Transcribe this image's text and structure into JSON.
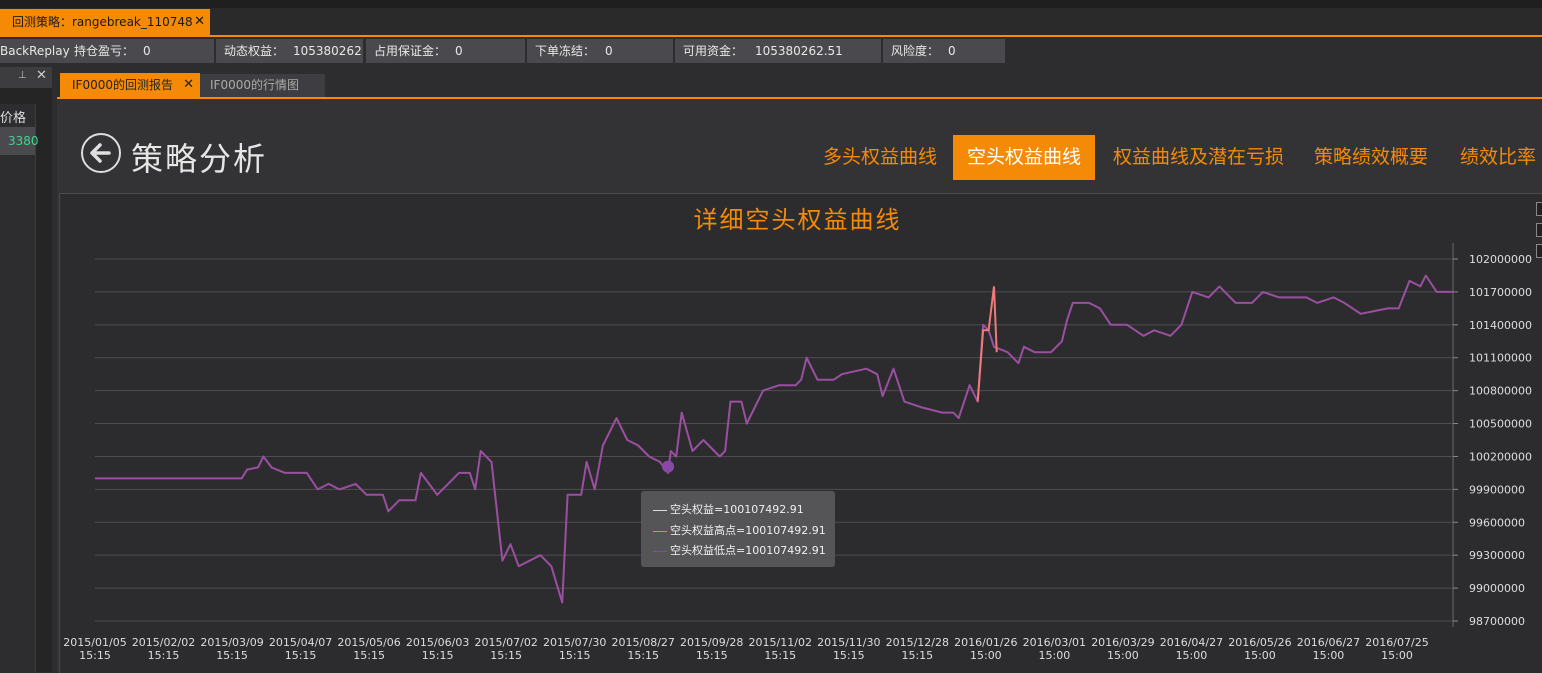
{
  "app": {
    "doc_tab_label": "回测策略：rangebreak_110748",
    "close_glyph": "✕"
  },
  "status_bar": {
    "left_label": "BackReplay",
    "fields": [
      {
        "label": "持仓盈亏：",
        "value": "0"
      },
      {
        "label": "动态权益：",
        "value": "105380262."
      },
      {
        "label": "占用保证金：",
        "value": "0"
      },
      {
        "label": "下单冻结：",
        "value": "0"
      },
      {
        "label": "可用资金：",
        "value": "105380262.51"
      },
      {
        "label": "风险度：",
        "value": "0"
      }
    ]
  },
  "left_panel": {
    "column_header": "价格",
    "row_value": "3380",
    "value_color": "#3dd68c"
  },
  "report_tabs": [
    {
      "label": "IF0000的回测报告",
      "active": true
    },
    {
      "label": "IF0000的行情图",
      "active": false
    }
  ],
  "header": {
    "title": "策略分析",
    "nav_tabs": [
      {
        "label": "多头权益曲线",
        "active": false
      },
      {
        "label": "空头权益曲线",
        "active": true
      },
      {
        "label": "权益曲线及潜在亏损",
        "active": false
      },
      {
        "label": "策略绩效概要",
        "active": false
      },
      {
        "label": "绩效比率",
        "active": false
      }
    ],
    "accent_color": "#f58a07"
  },
  "chart_data": {
    "type": "line",
    "title": "详细空头权益曲线",
    "x_ticks": [
      [
        "2015/01/05",
        "15:15"
      ],
      [
        "2015/02/02",
        "15:15"
      ],
      [
        "2015/03/09",
        "15:15"
      ],
      [
        "2015/04/07",
        "15:15"
      ],
      [
        "2015/05/06",
        "15:15"
      ],
      [
        "2015/06/03",
        "15:15"
      ],
      [
        "2015/07/02",
        "15:15"
      ],
      [
        "2015/07/30",
        "15:15"
      ],
      [
        "2015/08/27",
        "15:15"
      ],
      [
        "2015/09/28",
        "15:15"
      ],
      [
        "2015/11/02",
        "15:15"
      ],
      [
        "2015/11/30",
        "15:15"
      ],
      [
        "2015/12/28",
        "15:15"
      ],
      [
        "2016/01/26",
        "15:00"
      ],
      [
        "2016/03/01",
        "15:00"
      ],
      [
        "2016/03/29",
        "15:00"
      ],
      [
        "2016/04/27",
        "15:00"
      ],
      [
        "2016/05/26",
        "15:00"
      ],
      [
        "2016/06/27",
        "15:00"
      ],
      [
        "2016/07/25",
        "15:00"
      ]
    ],
    "y_ticks": [
      "102000000",
      "101700000",
      "101400000",
      "101100000",
      "100800000",
      "100500000",
      "100200000",
      "99900000",
      "99600000",
      "99300000",
      "99000000",
      "98700000"
    ],
    "ylim": [
      98700000,
      102000000
    ],
    "series": [
      {
        "name": "空头权益",
        "color": "#9a4fa0"
      },
      {
        "name": "空头权益高点",
        "color": "#f07a7a"
      },
      {
        "name": "空头权益低点",
        "color": "#7a4ac8"
      }
    ],
    "main_points": [
      [
        0,
        100000000
      ],
      [
        2.7,
        100000000
      ],
      [
        2.8,
        100080000
      ],
      [
        3.0,
        100100000
      ],
      [
        3.1,
        100200000
      ],
      [
        3.25,
        100100000
      ],
      [
        3.5,
        100050000
      ],
      [
        3.9,
        100050000
      ],
      [
        4.1,
        99900000
      ],
      [
        4.3,
        99950000
      ],
      [
        4.5,
        99900000
      ],
      [
        4.8,
        99950000
      ],
      [
        5.0,
        99850000
      ],
      [
        5.3,
        99850000
      ],
      [
        5.4,
        99700000
      ],
      [
        5.6,
        99800000
      ],
      [
        5.9,
        99800000
      ],
      [
        6.0,
        100050000
      ],
      [
        6.3,
        99850000
      ],
      [
        6.5,
        99950000
      ],
      [
        6.7,
        100050000
      ],
      [
        6.9,
        100050000
      ],
      [
        7.0,
        99900000
      ],
      [
        7.1,
        100250000
      ],
      [
        7.3,
        100150000
      ],
      [
        7.5,
        99250000
      ],
      [
        7.65,
        99400000
      ],
      [
        7.8,
        99200000
      ],
      [
        8.0,
        99250000
      ],
      [
        8.2,
        99300000
      ],
      [
        8.4,
        99200000
      ],
      [
        8.6,
        98870000
      ],
      [
        8.7,
        99850000
      ],
      [
        8.95,
        99850000
      ],
      [
        9.05,
        100150000
      ],
      [
        9.2,
        99900000
      ],
      [
        9.35,
        100300000
      ],
      [
        9.6,
        100550000
      ],
      [
        9.8,
        100350000
      ],
      [
        10.0,
        100300000
      ],
      [
        10.2,
        100200000
      ],
      [
        10.4,
        100150000
      ],
      [
        10.55,
        100050000
      ],
      [
        10.6,
        100250000
      ],
      [
        10.7,
        100200000
      ],
      [
        10.8,
        100600000
      ],
      [
        11.0,
        100250000
      ],
      [
        11.2,
        100350000
      ],
      [
        11.5,
        100200000
      ],
      [
        11.6,
        100250000
      ],
      [
        11.7,
        100700000
      ],
      [
        11.9,
        100700000
      ],
      [
        12.0,
        100500000
      ],
      [
        12.3,
        100800000
      ],
      [
        12.6,
        100850000
      ],
      [
        12.9,
        100850000
      ],
      [
        13.0,
        100900000
      ],
      [
        13.1,
        101100000
      ],
      [
        13.3,
        100900000
      ],
      [
        13.6,
        100900000
      ],
      [
        13.75,
        100950000
      ],
      [
        14.2,
        101000000
      ],
      [
        14.4,
        100950000
      ],
      [
        14.5,
        100750000
      ],
      [
        14.7,
        101000000
      ],
      [
        14.9,
        100700000
      ],
      [
        15.2,
        100650000
      ],
      [
        15.6,
        100600000
      ],
      [
        15.8,
        100600000
      ],
      [
        15.9,
        100550000
      ],
      [
        16.1,
        100850000
      ],
      [
        16.25,
        100700000
      ],
      [
        16.35,
        101400000
      ],
      [
        16.45,
        101350000
      ],
      [
        16.55,
        101200000
      ],
      [
        16.8,
        101150000
      ],
      [
        17.0,
        101050000
      ],
      [
        17.1,
        101200000
      ],
      [
        17.3,
        101150000
      ],
      [
        17.6,
        101150000
      ],
      [
        17.8,
        101250000
      ],
      [
        17.9,
        101450000
      ],
      [
        18.0,
        101600000
      ],
      [
        18.3,
        101600000
      ],
      [
        18.5,
        101550000
      ],
      [
        18.7,
        101400000
      ],
      [
        19.0,
        101400000
      ],
      [
        19.3,
        101300000
      ],
      [
        19.5,
        101350000
      ],
      [
        19.8,
        101300000
      ],
      [
        20.0,
        101400000
      ],
      [
        20.2,
        101700000
      ],
      [
        20.5,
        101650000
      ],
      [
        20.7,
        101750000
      ],
      [
        21.0,
        101600000
      ],
      [
        21.3,
        101600000
      ],
      [
        21.5,
        101700000
      ],
      [
        21.8,
        101650000
      ],
      [
        22.0,
        101650000
      ],
      [
        22.3,
        101650000
      ],
      [
        22.5,
        101600000
      ],
      [
        22.8,
        101650000
      ],
      [
        23.0,
        101600000
      ],
      [
        23.3,
        101500000
      ],
      [
        23.8,
        101550000
      ],
      [
        24.0,
        101550000
      ],
      [
        24.2,
        101800000
      ],
      [
        24.4,
        101750000
      ],
      [
        24.5,
        101850000
      ],
      [
        24.7,
        101700000
      ],
      [
        25.0,
        101700000
      ]
    ],
    "high_spike": [
      [
        16.25,
        100700000
      ],
      [
        16.35,
        101350000
      ],
      [
        16.45,
        101350000
      ],
      [
        16.55,
        101750000
      ],
      [
        16.6,
        101150000
      ]
    ],
    "marker_point": [
      10.55,
      100107492.91
    ],
    "x_domain": [
      0,
      25
    ],
    "tooltip": [
      "空头权益=100107492.91",
      "空头权益高点=100107492.91",
      "空头权益低点=100107492.91"
    ],
    "grid": true
  }
}
